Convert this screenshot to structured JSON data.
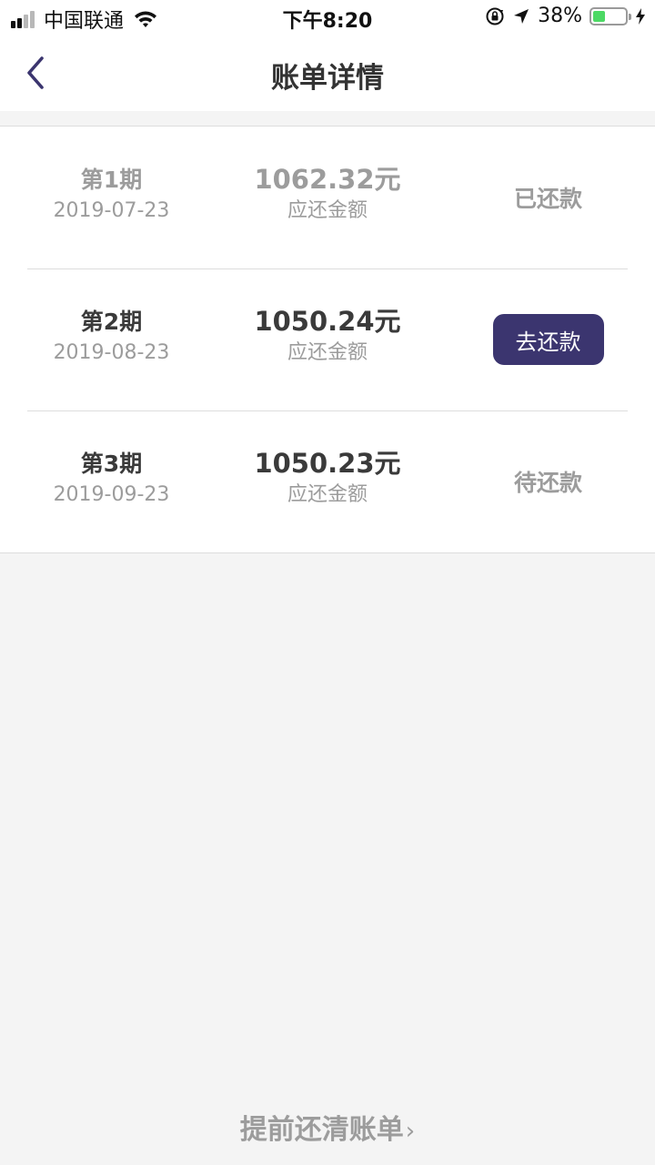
{
  "status_bar": {
    "carrier": "中国联通",
    "time": "下午8:20",
    "battery_percent": "38%",
    "battery_level": 0.38
  },
  "nav": {
    "title": "账单详情"
  },
  "bills": [
    {
      "period": "第1期",
      "date": "2019-07-23",
      "amount": "1062.32元",
      "amount_label": "应还金额",
      "status": "已还款"
    },
    {
      "period": "第2期",
      "date": "2019-08-23",
      "amount": "1050.24元",
      "amount_label": "应还金额",
      "status": "去还款"
    },
    {
      "period": "第3期",
      "date": "2019-09-23",
      "amount": "1050.23元",
      "amount_label": "应还金额",
      "status": "待还款"
    }
  ],
  "footer": {
    "early_payoff_label": "提前还清账单",
    "chevron": "›"
  },
  "colors": {
    "accent": "#3b356f",
    "muted_text": "#9c9c9c",
    "dark_text": "#3a3a3a",
    "battery_green": "#4cd964",
    "background": "#f4f4f4"
  }
}
